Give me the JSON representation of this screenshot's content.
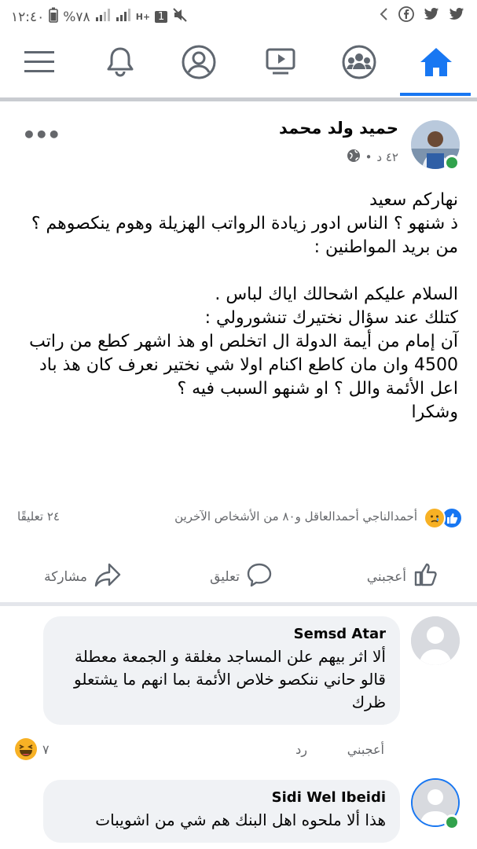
{
  "status_bar": {
    "time": "١٢:٤٠",
    "battery": "%٧٨",
    "network": "H+",
    "sim": "1"
  },
  "nav": {
    "items": [
      "menu",
      "notifications",
      "profile",
      "watch",
      "groups",
      "home"
    ],
    "active": "home",
    "accent": "#1877f2"
  },
  "post": {
    "author": "حميد ولد محمد",
    "time": "٤٢ د",
    "dot": "•",
    "privacy_icon": "globe-icon",
    "body": [
      "نهاركم سعيد",
      "ذ شنهو ؟ الناس ادور زيادة الرواتب الهزيلة وهوم ينكصوهم ؟",
      "من بريد المواطنين :",
      "",
      "السلام عليكم اشحالك اياك لباس .",
      "كتلك عند سؤال نختيرك تنشورولي :",
      "آن إمام من أيمة الدولة ال اتخلص او هذ اشهر كطع من راتب 4500 وان مان كاطع اكنام اولا شي نختير نعرف كان هذ باد اعل الأئمة والل ؟ او شنهو السبب فيه ؟",
      "وشكرا"
    ],
    "reactions_text": "أحمدالناجي أحمدالعاقل و٨٠ من الأشخاص الآخرين",
    "comments_count": "٢٤ تعليقًا"
  },
  "actions": {
    "like": "أعجبني",
    "comment": "تعليق",
    "share": "مشاركة"
  },
  "comments": [
    {
      "name": "Semsd Atar",
      "text": "ألا اثر بيهم علن المساجد مغلقة و الجمعة معطلة قالو حاني ننكصو خلاص الأئمة بما انهم ما يشتعلو ظرك",
      "like_label": "أعجبني",
      "reply_label": "رد",
      "reaction_count": "٧"
    },
    {
      "name": "Sidi Wel Ibeidi",
      "text": "هذا ألا ملحوه اهل البنك هم شي من اشويبات"
    }
  ]
}
